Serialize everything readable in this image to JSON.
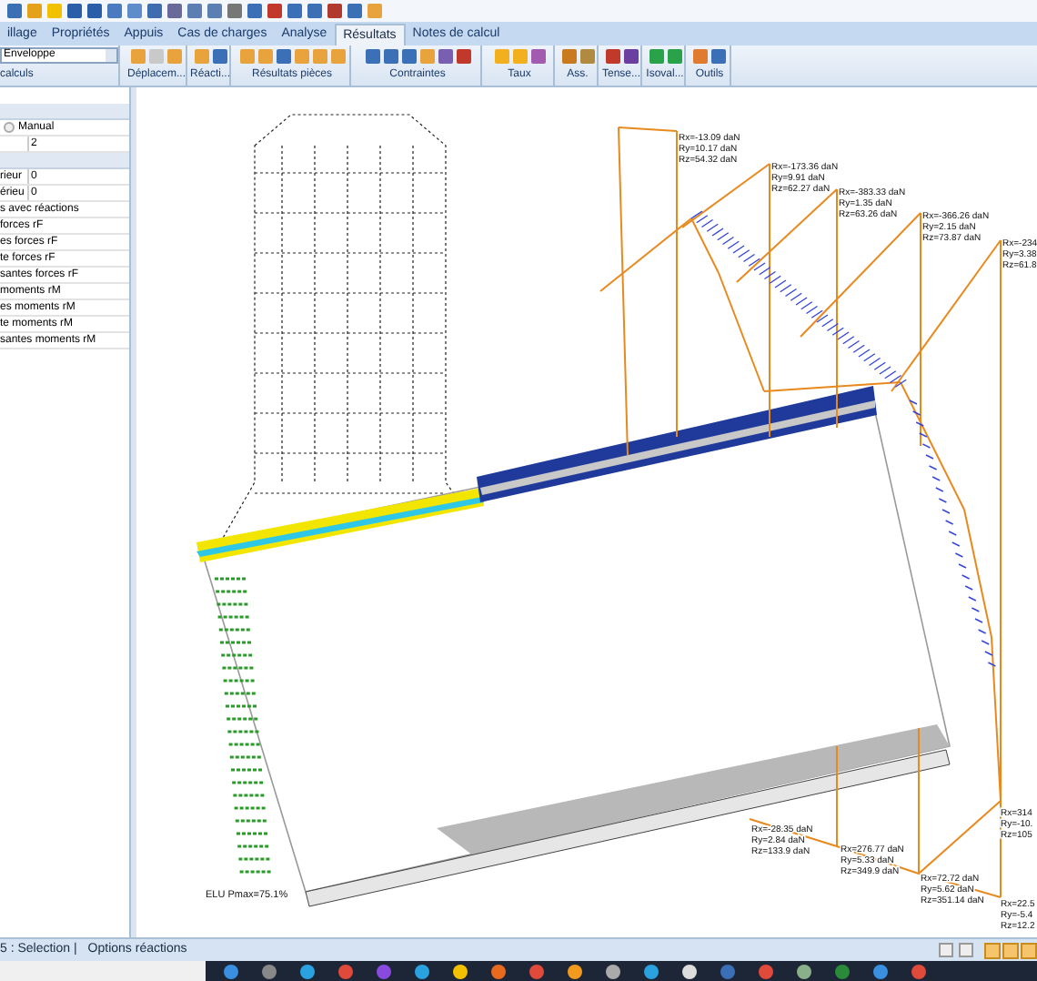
{
  "menu_tabs": [
    {
      "label": "illage",
      "selected": false
    },
    {
      "label": "Propriétés",
      "selected": false
    },
    {
      "label": "Appuis",
      "selected": false
    },
    {
      "label": "Cas de charges",
      "selected": false
    },
    {
      "label": "Analyse",
      "selected": false
    },
    {
      "label": "Résultats",
      "selected": true
    },
    {
      "label": "Notes de calcul",
      "selected": false
    }
  ],
  "ribbon": {
    "combo": {
      "value": "Enveloppe",
      "label": "calculs"
    },
    "groups": [
      {
        "label": "Déplacem..."
      },
      {
        "label": "Réacti..."
      },
      {
        "label": "Résultats pièces"
      },
      {
        "label": "Contraintes"
      },
      {
        "label": "Taux"
      },
      {
        "label": "Ass."
      },
      {
        "label": "Tense..."
      },
      {
        "label": "Isoval..."
      },
      {
        "label": "Outils"
      }
    ]
  },
  "side_panel": {
    "radio": {
      "label": "Manual",
      "selected": false
    },
    "value_row": "2",
    "rows": [
      {
        "label": "rieur",
        "value": "0"
      },
      {
        "label": "érieu",
        "value": "0"
      }
    ],
    "items": [
      "s avec réactions",
      "forces rF",
      "es forces rF",
      "te forces rF",
      "santes forces rF",
      "moments rM",
      "es moments rM",
      "te moments rM",
      "santes moments rM"
    ]
  },
  "canvas": {
    "caption": "ELU Pmax=75.1%",
    "reactions": [
      {
        "lines": [
          "Rx=-13.09 daN",
          "Ry=10.17 daN",
          "Rz=54.32 daN"
        ]
      },
      {
        "lines": [
          "Rx=-173.36 daN",
          "Ry=9.91 daN",
          "Rz=62.27 daN"
        ]
      },
      {
        "lines": [
          "Rx=-383.33 daN",
          "Ry=1.35 daN",
          "Rz=63.26 daN"
        ]
      },
      {
        "lines": [
          "Rx=-366.26 daN",
          "Ry=2.15 daN",
          "Rz=73.87 daN"
        ]
      },
      {
        "lines": [
          "Rx=-234",
          "Ry=3.38",
          "Rz=61.8"
        ]
      },
      {
        "lines": [
          "Rx=-28.35 daN",
          "Ry=2.84 daN",
          "Rz=133.9 daN"
        ]
      },
      {
        "lines": [
          "Rx=276.77 daN",
          "Ry=5.33 daN",
          "Rz=349.9 daN"
        ]
      },
      {
        "lines": [
          "Rx=72.72 daN",
          "Ry=5.62 daN",
          "Rz=351.14 daN"
        ]
      },
      {
        "lines": [
          "Rx=314",
          "Ry=-10.",
          "Rz=105"
        ]
      },
      {
        "lines": [
          "Rx=22.5",
          "Ry=-5.4",
          "Rz=12.2"
        ]
      }
    ]
  },
  "status_bar": {
    "left": "5 : Selection |",
    "right": "Options réactions"
  }
}
